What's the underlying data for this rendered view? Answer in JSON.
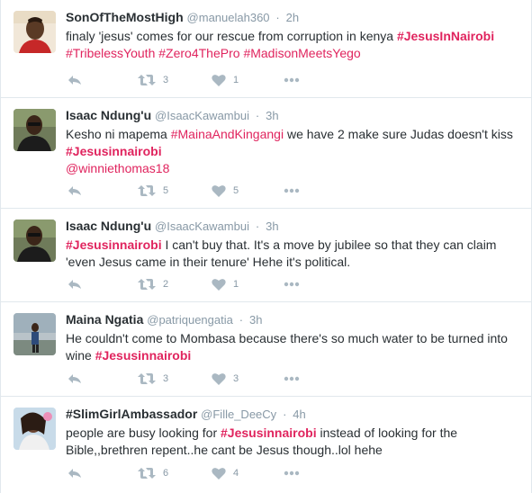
{
  "colors": {
    "hashtag": "#e0245e",
    "muted": "#8899a6",
    "icon": "#aab8c2",
    "border": "#e1e8ed"
  },
  "tweets": [
    {
      "fullname": "SonOfTheMostHigh",
      "username": "@manuelah360",
      "sep": "·",
      "time": "2h",
      "text": [
        {
          "t": "finaly 'jesus' comes for our rescue from corruption in kenya "
        },
        {
          "t": "#JesusInNairobi",
          "tag": "bold"
        },
        {
          "br": true
        },
        {
          "t": "#TribelessYouth",
          "tag": "normal"
        },
        {
          "t": " "
        },
        {
          "t": "#Zero4ThePro",
          "tag": "normal"
        },
        {
          "t": " "
        },
        {
          "t": "#MadisonMeetsYego",
          "tag": "normal"
        }
      ],
      "retweets": "3",
      "likes": "1",
      "avatar_icon": "user-avatar"
    },
    {
      "fullname": "Isaac Ndung'u",
      "username": "@IsaacKawambui",
      "sep": "·",
      "time": "3h",
      "text": [
        {
          "t": "Kesho ni mapema "
        },
        {
          "t": "#MainaAndKingangi",
          "tag": "normal"
        },
        {
          "t": " we have 2 make sure Judas doesn't kiss"
        },
        {
          "br": true
        },
        {
          "t": "#Jesusinnairobi",
          "tag": "bold"
        },
        {
          "br": true
        },
        {
          "t": "@winniethomas18",
          "tag": "mention"
        }
      ],
      "retweets": "5",
      "likes": "5",
      "avatar_icon": "user-avatar"
    },
    {
      "fullname": "Isaac Ndung'u",
      "username": "@IsaacKawambui",
      "sep": "·",
      "time": "3h",
      "text": [
        {
          "t": "#Jesusinnairobi",
          "tag": "bold"
        },
        {
          "t": " I can't buy that. It's a move by jubilee so that they can claim"
        },
        {
          "br": true
        },
        {
          "t": "'even Jesus came in their tenure' Hehe it's political."
        }
      ],
      "retweets": "2",
      "likes": "1",
      "avatar_icon": "user-avatar"
    },
    {
      "fullname": "Maina Ngatia",
      "username": "@patriquengatia",
      "sep": "·",
      "time": "3h",
      "text": [
        {
          "t": "He couldn't come to Mombasa because there's so much water to be turned into"
        },
        {
          "br": true
        },
        {
          "t": "wine  "
        },
        {
          "t": "#Jesusinnairobi",
          "tag": "bold"
        }
      ],
      "retweets": "3",
      "likes": "3",
      "avatar_icon": "user-avatar"
    },
    {
      "fullname": "#SlimGirlAmbassador",
      "username": "@Fille_DeeCy",
      "sep": "·",
      "time": "4h",
      "text": [
        {
          "t": "people are busy looking for "
        },
        {
          "t": "#Jesusinnairobi",
          "tag": "bold"
        },
        {
          "t": " instead of looking for the"
        },
        {
          "br": true
        },
        {
          "t": "Bible,,brethren repent..he cant be Jesus though..lol hehe"
        }
      ],
      "retweets": "6",
      "likes": "4",
      "avatar_icon": "user-avatar"
    }
  ]
}
